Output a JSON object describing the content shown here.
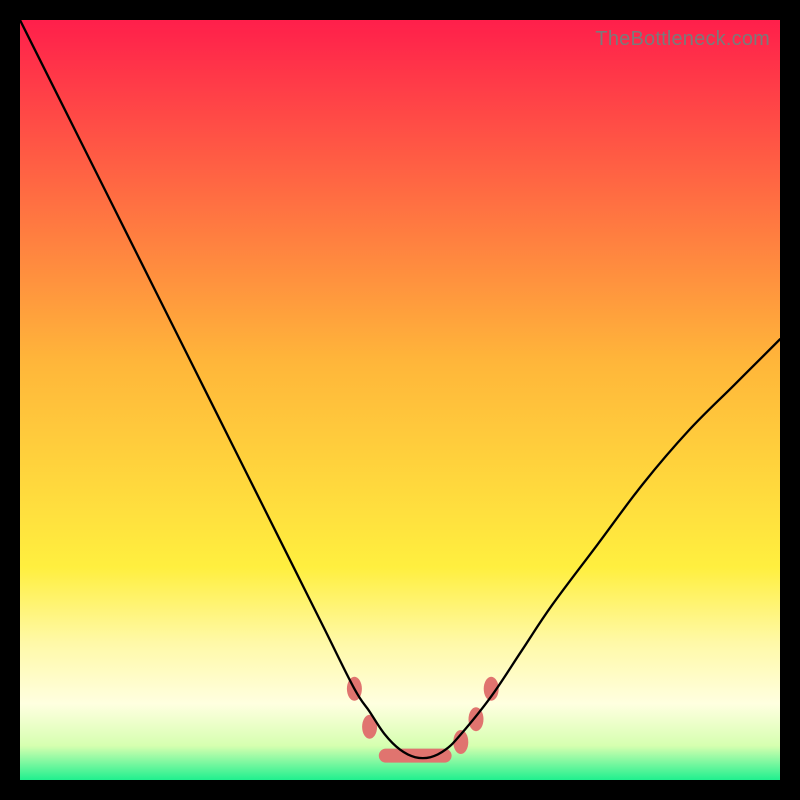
{
  "watermark": {
    "text": "TheBottleneck.com"
  },
  "chart_data": {
    "type": "line",
    "title": "",
    "xlabel": "",
    "ylabel": "",
    "xlim": [
      0,
      100
    ],
    "ylim": [
      0,
      100
    ],
    "grid": false,
    "legend": false,
    "background_gradient": {
      "type": "vertical",
      "stops": [
        {
          "offset": 0.0,
          "color": "#ff1f4b"
        },
        {
          "offset": 0.45,
          "color": "#ffb63a"
        },
        {
          "offset": 0.72,
          "color": "#ffef3f"
        },
        {
          "offset": 0.82,
          "color": "#fff9a8"
        },
        {
          "offset": 0.9,
          "color": "#ffffe0"
        },
        {
          "offset": 0.955,
          "color": "#d6ffb0"
        },
        {
          "offset": 1.0,
          "color": "#20f08f"
        }
      ]
    },
    "series": [
      {
        "name": "bottleneck-curve",
        "color": "#000000",
        "stroke_width": 2.3,
        "x": [
          0,
          4,
          8,
          12,
          16,
          20,
          24,
          28,
          32,
          36,
          40,
          44,
          46,
          48,
          50,
          52,
          54,
          56,
          58,
          62,
          66,
          70,
          76,
          82,
          88,
          94,
          100
        ],
        "y": [
          100,
          92,
          84,
          76,
          68,
          60,
          52,
          44,
          36,
          28,
          20,
          12,
          9,
          6,
          4,
          3,
          3,
          4,
          6,
          11,
          17,
          23,
          31,
          39,
          46,
          52,
          58
        ]
      }
    ],
    "markers": {
      "name": "bottom-segment-markers",
      "shape": "rounded-capsule",
      "color": "#e0746f",
      "points": [
        {
          "x": 44,
          "y": 12
        },
        {
          "x": 46,
          "y": 7
        },
        {
          "x": 48,
          "y": 4
        },
        {
          "x": 50,
          "y": 3.4
        },
        {
          "x": 52,
          "y": 3
        },
        {
          "x": 54,
          "y": 3
        },
        {
          "x": 56,
          "y": 3.5
        },
        {
          "x": 58,
          "y": 5
        },
        {
          "x": 60,
          "y": 8
        },
        {
          "x": 62,
          "y": 12
        }
      ]
    }
  }
}
